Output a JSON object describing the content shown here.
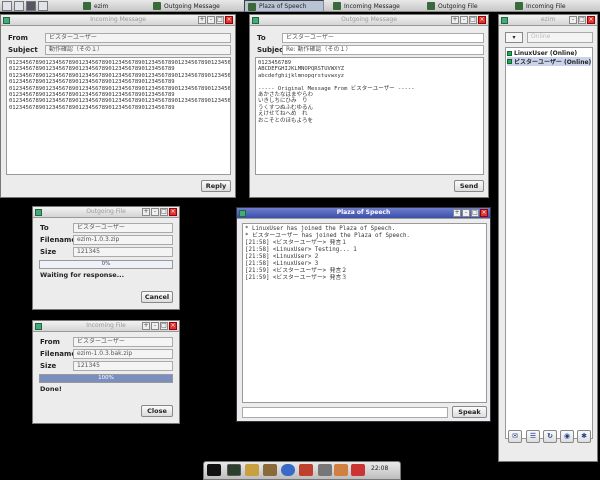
{
  "taskbar": {
    "tasks": [
      {
        "label": "ezim"
      },
      {
        "label": "Outgoing Message"
      },
      {
        "label": "Plaza of Speech"
      },
      {
        "label": "Incoming Message"
      },
      {
        "label": "Outgoing File"
      },
      {
        "label": "Incoming File"
      }
    ]
  },
  "incoming_message": {
    "title": "Incoming Message",
    "from_label": "From",
    "from_value": "ビスターユーザー",
    "subject_label": "Subject",
    "subject_value": "動作確認（その１）",
    "body": "0123456789012345678901234567890123456789012345678901234567890123456789012345678901234567890123456789\n01234567890123456789012345678901234567890123456789\n0123456789012345678901234567890123456789012345678901234567890123456789012345678901234567890123456789\n01234567890123456789012345678901234567890123456789\n0123456789012345678901234567890123456789012345678901234567890123456789012345678901234567890123456789\n01234567890123456789012345678901234567890123456789\n0123456789012345678901234567890123456789012345678901234567890123456789012345678901234567890123456789\n01234567890123456789012345678901234567890123456789",
    "reply_label": "Reply"
  },
  "outgoing_message": {
    "title": "Outgoing Message",
    "to_label": "To",
    "to_value": "ビスターユーザー",
    "subject_label": "Subject",
    "subject_value": "Re: 動作確認（その１）",
    "body": "0123456789\nABCDEFGHIJKLMNOPQRSTUVWXYZ\nabcdefghijklmnopqrstuvwxyz\n\n----- Original Message From ビスターユーザー -----\nあかさたなはまやらわ\nいきしちにひみ　り\nうくすつぬふむゆるん\nえけせてねへめ　れ\nおこそとのほもよろを",
    "send_label": "Send"
  },
  "ezim": {
    "title": "ezim",
    "status_placeholder": "Online",
    "users": [
      {
        "name": "LinuxUser (Online)"
      },
      {
        "name": "ビスターユーザー (Online)"
      }
    ]
  },
  "outgoing_file": {
    "title": "Outgoing File",
    "to_label": "To",
    "to_value": "ビスターユーザー",
    "filename_label": "Filename",
    "filename_value": "ezim-1.0.3.zip",
    "size_label": "Size",
    "size_value": "121345",
    "progress_text": "0%",
    "progress": 0,
    "status": "Waiting for response...",
    "cancel_label": "Cancel"
  },
  "incoming_file": {
    "title": "Incoming File",
    "from_label": "From",
    "from_value": "ビスターユーザー",
    "filename_label": "Filename",
    "filename_value": "ezim-1.0.3.bak.zip",
    "size_label": "Size",
    "size_value": "121345",
    "progress_text": "100%",
    "progress": 1,
    "status": "Done!",
    "close_label": "Close"
  },
  "plaza": {
    "title": "Plaza of Speech",
    "log": "* LinuxUser has joined the Plaza of Speech.\n* ビスターユーザー has joined the Plaza of Speech.\n[21:58] <ビスターユーザー> 発言１\n[21:58] <LinuxUser> Testing... 1\n[21:58] <LinuxUser> 2\n[21:58] <LinuxUser> 3\n[21:59] <ビスターユーザー> 発言２\n[21:59] <ビスターユーザー> 発言３",
    "speak_label": "Speak"
  },
  "dock": {
    "clock": "22:08"
  }
}
